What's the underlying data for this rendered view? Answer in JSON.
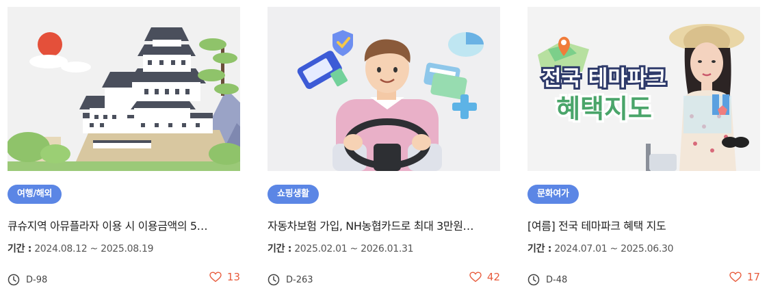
{
  "cards": [
    {
      "category": "여행/해외",
      "title": "큐슈지역 아뮤플라자 이용 시 이용금액의 5…",
      "period_label": "기간 :",
      "period": "2024.08.12 ~ 2025.08.19",
      "dday": "D-98",
      "likes": "13",
      "image": "japanese-castle-illustration"
    },
    {
      "category": "쇼핑생활",
      "title": "자동차보험 가입, NH농협카드로 최대 3만원…",
      "period_label": "기간 :",
      "period": "2025.02.01 ~ 2026.01.31",
      "dday": "D-263",
      "likes": "42",
      "image": "driver-with-cards-illustration"
    },
    {
      "category": "문화여가",
      "title": "[여름] 전국 테마파크 혜택 지도",
      "period_label": "기간 :",
      "period": "2024.07.01 ~ 2025.06.30",
      "dday": "D-48",
      "likes": "17",
      "image": "theme-park-map-banner",
      "banner_line1": "전국 테마파크",
      "banner_line2": "혜택지도"
    }
  ],
  "icons": {
    "dday": "clock-icon",
    "like": "heart-icon"
  },
  "colors": {
    "badge": "#5b86e5",
    "like": "#e85b3c",
    "banner_green": "#4aa56a"
  }
}
